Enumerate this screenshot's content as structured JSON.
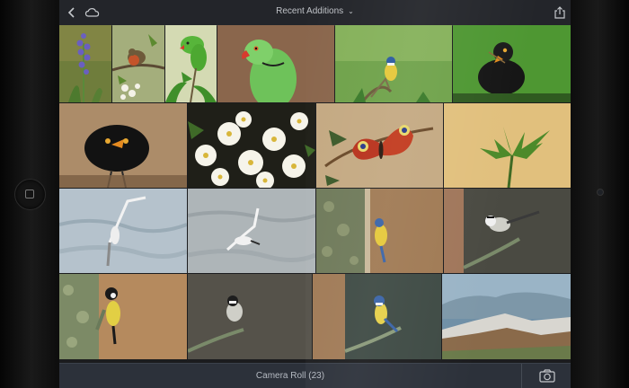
{
  "header": {
    "title": "Recent Additions",
    "back_icon": "chevron-left-icon",
    "cloud_icon": "cloud-icon",
    "share_icon": "share-icon"
  },
  "footer": {
    "label": "Camera Roll (23)",
    "camera_icon": "camera-icon"
  },
  "photos": [
    {
      "subject": "bluebell-flower"
    },
    {
      "subject": "robin-on-branch"
    },
    {
      "subject": "green-parakeet-on-branch"
    },
    {
      "subject": "green-parakeet-portrait"
    },
    {
      "subject": "blue-tit-on-twig"
    },
    {
      "subject": "blackbird-with-food"
    },
    {
      "subject": "blackbird-on-ground"
    },
    {
      "subject": "white-flowers"
    },
    {
      "subject": "peacock-butterfly"
    },
    {
      "subject": "fern-sprout"
    },
    {
      "subject": "gull-in-flight"
    },
    {
      "subject": "gull-in-flight-water"
    },
    {
      "subject": "blue-tit-on-tree-trunk"
    },
    {
      "subject": "great-tit-on-branch"
    },
    {
      "subject": "great-tit-on-tree"
    },
    {
      "subject": "coal-tit-on-branch"
    },
    {
      "subject": "blue-tit-on-branch"
    },
    {
      "subject": "mountain-landscape"
    }
  ]
}
